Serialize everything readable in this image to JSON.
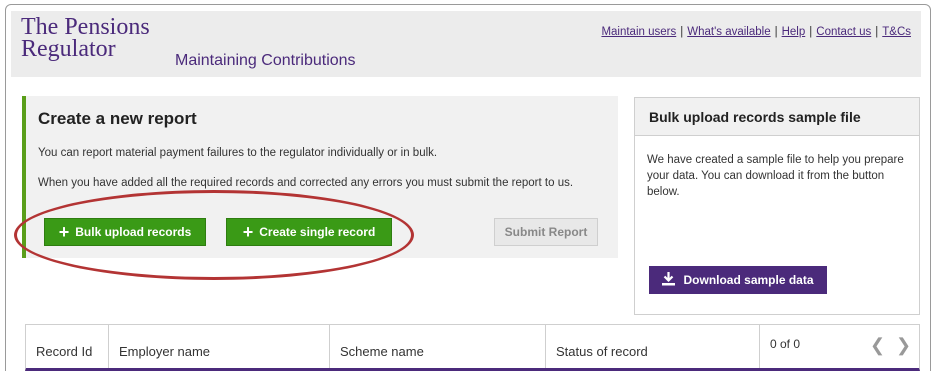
{
  "header": {
    "logo_line1": "The Pensions",
    "logo_line2": "Regulator",
    "app_title": "Maintaining Contributions",
    "links": [
      "Maintain users",
      "What's available",
      "Help",
      "Contact us",
      "T&Cs"
    ]
  },
  "report": {
    "title": "Create a new report",
    "text1": "You can report material payment failures to the regulator individually or in bulk.",
    "text2": "When you have added all the required records and corrected any errors you must submit the report to us.",
    "bulk_button": "Bulk upload records",
    "single_button": "Create single record",
    "submit_button": "Submit Report"
  },
  "sample": {
    "title": "Bulk upload records sample file",
    "text": "We have created a sample file to help you prepare your data. You can download it from the button below.",
    "download_button": "Download sample data"
  },
  "table": {
    "columns": [
      "Record Id",
      "Employer name",
      "Scheme name",
      "Status of record"
    ],
    "pager_count": "0 of 0"
  },
  "colors": {
    "brand_purple": "#4b2a7b",
    "action_green": "#3a9a16",
    "highlight_red": "#b33434"
  }
}
